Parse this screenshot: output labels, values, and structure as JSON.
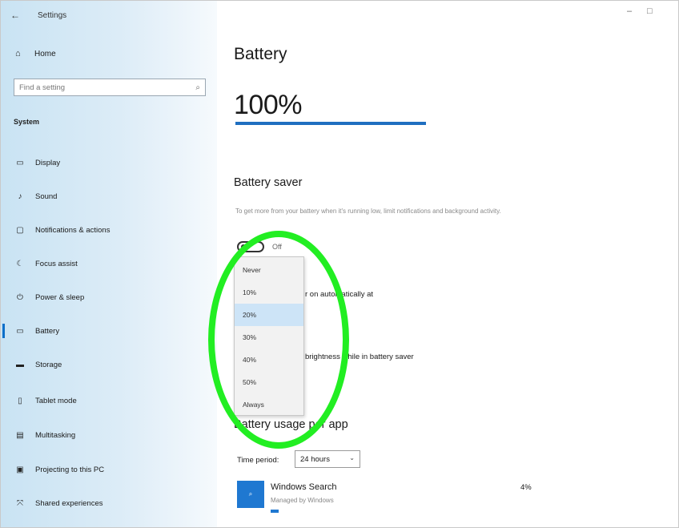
{
  "titlebar": {
    "title": "Settings"
  },
  "sidebar": {
    "home": "Home",
    "search_placeholder": "Find a setting",
    "section": "System",
    "items": [
      {
        "label": "Display",
        "icon": "monitor-icon"
      },
      {
        "label": "Sound",
        "icon": "speaker-icon"
      },
      {
        "label": "Notifications & actions",
        "icon": "notification-icon"
      },
      {
        "label": "Focus assist",
        "icon": "moon-icon"
      },
      {
        "label": "Power & sleep",
        "icon": "power-icon"
      },
      {
        "label": "Battery",
        "icon": "battery-icon",
        "active": true
      },
      {
        "label": "Storage",
        "icon": "storage-icon"
      },
      {
        "label": "Tablet mode",
        "icon": "tablet-icon"
      },
      {
        "label": "Multitasking",
        "icon": "multitasking-icon"
      },
      {
        "label": "Projecting to this PC",
        "icon": "projector-icon"
      },
      {
        "label": "Shared experiences",
        "icon": "shared-icon"
      }
    ]
  },
  "main": {
    "title": "Battery",
    "percent_label": "100%",
    "percent_value": 1.0,
    "battery_saver_heading": "Battery saver",
    "battery_saver_desc": "To get more from your battery when it's running low, limit notifications and background activity.",
    "toggle_label": "Off",
    "auto_on_snip": "r on automatically at",
    "brightness_snip": "brightness while in battery saver",
    "usage_heading": "Battery usage per app",
    "time_period_label": "Time period:",
    "time_period_value": "24 hours",
    "app": {
      "name": "Windows Search",
      "sub": "Managed by Windows",
      "percent": "4%",
      "tile_icon": "search-icon"
    }
  },
  "dropdown": {
    "options": [
      "Never",
      "10%",
      "20%",
      "30%",
      "40%",
      "50%",
      "Always"
    ],
    "selected_index": 2
  },
  "colors": {
    "accent": "#1f6fc0",
    "annotation": "#22ee22"
  }
}
